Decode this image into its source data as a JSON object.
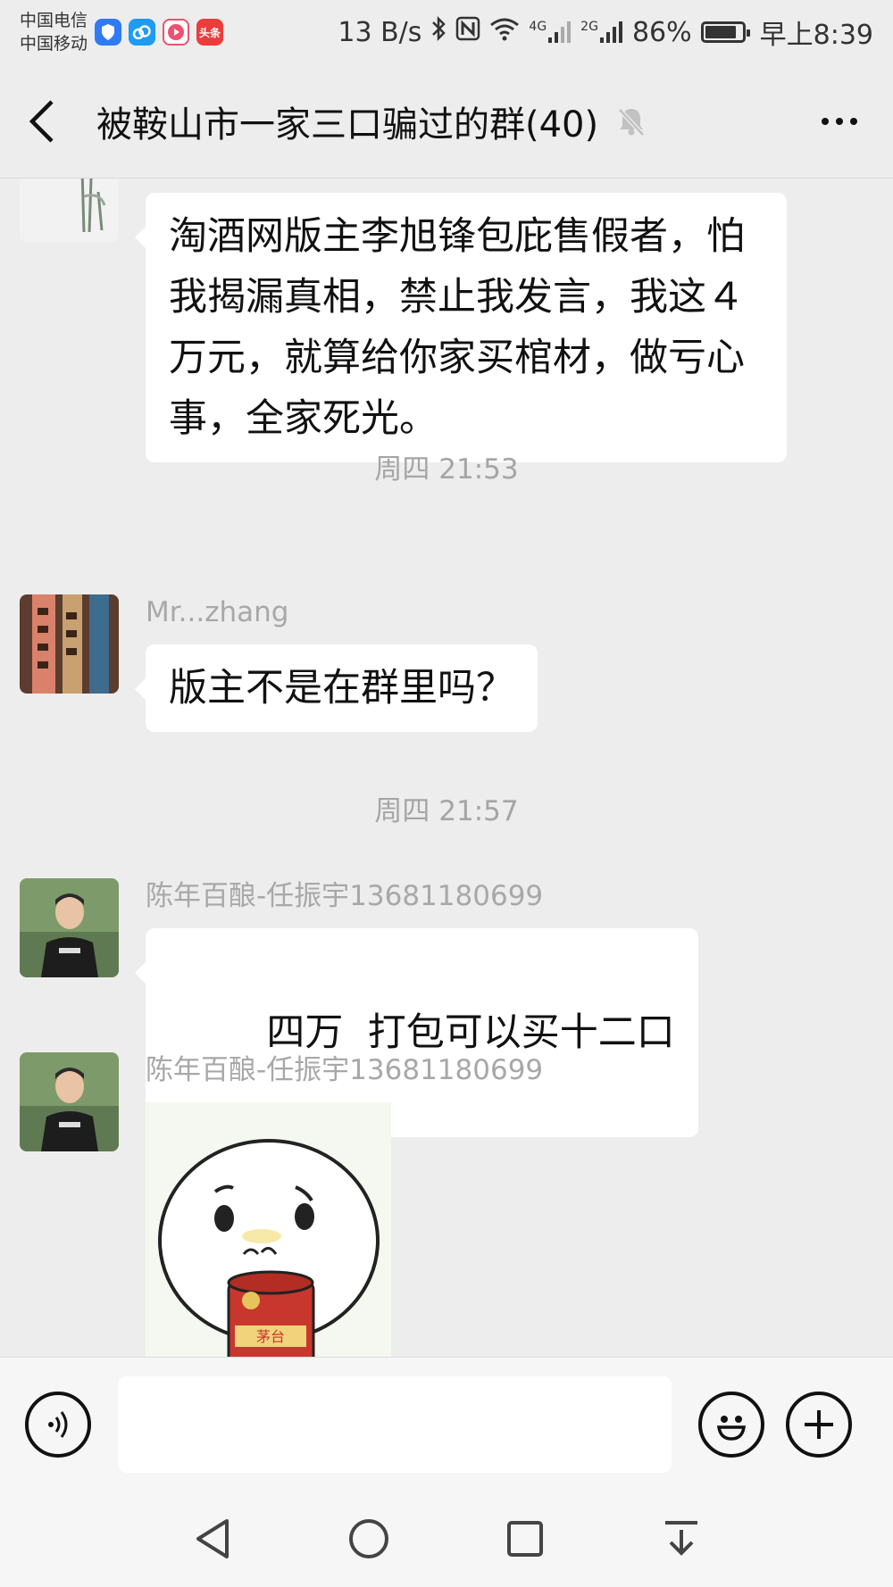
{
  "status_bar": {
    "carrier1": "中国电信",
    "carrier2": "中国移动",
    "net_speed": "13 B/s",
    "net_4g": "4G",
    "net_2g": "2G",
    "battery": "86%",
    "battery_level": 0.86,
    "time": "早上8:39",
    "app_icons": [
      {
        "name": "shield-app-icon",
        "color": "#2f7bf6"
      },
      {
        "name": "cloud-app-icon",
        "color": "#1e9bf5"
      },
      {
        "name": "video-app-icon",
        "color": "#f0506e"
      },
      {
        "name": "toutiao-app-icon",
        "label": "头条",
        "color": "#ee3b3b"
      }
    ]
  },
  "header": {
    "title": "被鞍山市一家三口骗过的群(40)",
    "icons": [
      "back-arrow-icon",
      "mute-bell-icon",
      "more-dots-icon"
    ]
  },
  "messages": [
    {
      "type": "text",
      "sender": "",
      "text": "淘酒网版主李旭锋包庇售假者，怕我揭漏真相，禁止我发言，我这４万元，就算给你家买棺材，做亏心事，全家死光。"
    },
    {
      "type": "time",
      "text": "周四 21:53"
    },
    {
      "type": "text",
      "sender": "Mr...zhang",
      "text": "版主不是在群里吗？"
    },
    {
      "type": "time",
      "text": "周四 21:57"
    },
    {
      "type": "text",
      "sender": "陈年百酿-任振宇13681180699",
      "text": "四万  打包可以买十二口"
    },
    {
      "type": "sticker",
      "sender": "陈年百酿-任振宇13681180699",
      "sticker_icon": "cartoon-drinking-sticker"
    }
  ],
  "input_bar": {
    "placeholder": "",
    "icons": [
      "voice-icon",
      "emoji-icon",
      "plus-icon"
    ]
  },
  "nav_bar": {
    "icons": [
      "back-triangle-icon",
      "home-circle-icon",
      "recents-square-icon",
      "notification-pull-icon"
    ]
  },
  "colors": {
    "background": "#ededed",
    "bubble": "#ffffff",
    "meta_text": "#a8a8a8"
  }
}
